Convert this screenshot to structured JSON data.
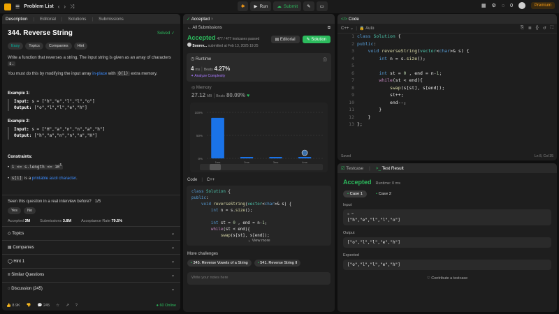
{
  "topbar": {
    "title": "Problem List",
    "run": "Run",
    "submit": "Submit",
    "counter": "0",
    "premium": "Premium"
  },
  "left": {
    "tabs": [
      "Description",
      "Editorial",
      "Solutions",
      "Submissions"
    ],
    "title": "344. Reverse String",
    "solved": "Solved",
    "chips": [
      "Easy",
      "Topics",
      "Companies",
      "Hint"
    ],
    "desc1": "Write a function that reverses a string. The input string is given as an array of characters",
    "desc1b": "s.",
    "desc2a": "You must do this by modifying the input array",
    "desc2link": "in-place",
    "desc2b": "with",
    "desc2code": "O(1)",
    "desc2c": "extra memory.",
    "ex1": {
      "h": "Example 1:",
      "inl": "Input:",
      "in": "s = [\"h\",\"e\",\"l\",\"l\",\"o\"]",
      "outl": "Output:",
      "out": "[\"o\",\"l\",\"l\",\"e\",\"h\"]"
    },
    "ex2": {
      "h": "Example 2:",
      "inl": "Input:",
      "in": "s = [\"H\",\"a\",\"n\",\"n\",\"a\",\"h\"]",
      "outl": "Output:",
      "out": "[\"h\",\"a\",\"n\",\"n\",\"a\",\"H\"]"
    },
    "cons": "Constraints:",
    "c1": "1 <= s.length <= 10",
    "c1sup": "5",
    "c2code": "s[i]",
    "c2a": "is a",
    "c2link": "printable ascii character",
    "seen": "Seen this question in a real interview before?",
    "seenfrac": "1/5",
    "yes": "Yes",
    "no": "No",
    "accLabel": "Accepted",
    "acc": "3M",
    "subLabel": "Submissions",
    "sub": "3.8M",
    "rateLabel": "Acceptance Rate",
    "rate": "79.5%",
    "acc_rows": [
      "Topics",
      "Companies",
      "Hint 1",
      "Similar Questions",
      "Discussion (245)"
    ],
    "footer": {
      "likes": "8.9K",
      "comments": "245",
      "online": "60 Online"
    }
  },
  "mid": {
    "tab": "Accepted",
    "back": "All Submissions",
    "status": "Accepted",
    "cases": "477 / 477 testcases passed",
    "user": "Soorev...",
    "submitted": "submitted at Feb 13, 2025 19:25",
    "editorial": "Editorial",
    "solution": "Solution",
    "rt_label": "Runtime",
    "rt_val": "4",
    "rt_unit": "ms",
    "beats_label": "Beats",
    "beats": "4.27%",
    "analyze": "Analyze Complexity",
    "mem_label": "Memory",
    "mem_val": "27.12",
    "mem_unit": "MB",
    "mem_beats_label": "Beats",
    "mem_beats": "80.09%",
    "code_label": "Code",
    "lang": "C++",
    "view_more": "View more",
    "more": "More challenges",
    "ch1": "345. Reverse Vowels of a String",
    "ch2": "541. Reverse String II",
    "notes": "Write your notes here"
  },
  "chart_data": {
    "type": "bar",
    "categories": [
      "1ms",
      "2ms",
      "3ms",
      "4ms"
    ],
    "values": [
      88,
      3,
      3,
      3
    ],
    "ylabel": "",
    "ylim": [
      0,
      100
    ],
    "yticks": [
      "100%",
      "50%",
      "0%"
    ]
  },
  "right": {
    "title": "Code",
    "lang": "C++",
    "auto": "Auto",
    "saved": "Saved",
    "pos": "Ln 8, Col 35",
    "lines": [
      "class Solution {",
      "public:",
      "    void reverseString(vector<char>& s) {",
      "        int n = s.size();",
      "",
      "        int st = 0 , end = n-1;",
      "        while(st < end){",
      "            swap(s[st], s[end]);",
      "            st++;",
      "            end--;",
      "        }",
      "    }",
      "};"
    ]
  },
  "bot": {
    "tab1": "Testcase",
    "tab2": "Test Result",
    "status": "Accepted",
    "runtime": "Runtime: 0 ms",
    "case1": "Case 1",
    "case2": "Case 2",
    "input": "Input",
    "svar": "s =",
    "sval": "[\"h\",\"e\",\"l\",\"l\",\"o\"]",
    "output": "Output",
    "oval": "[\"o\",\"l\",\"l\",\"e\",\"h\"]",
    "expected": "Expected",
    "eval": "[\"o\",\"l\",\"l\",\"e\",\"h\"]",
    "contrib": "Contribute a testcase"
  }
}
